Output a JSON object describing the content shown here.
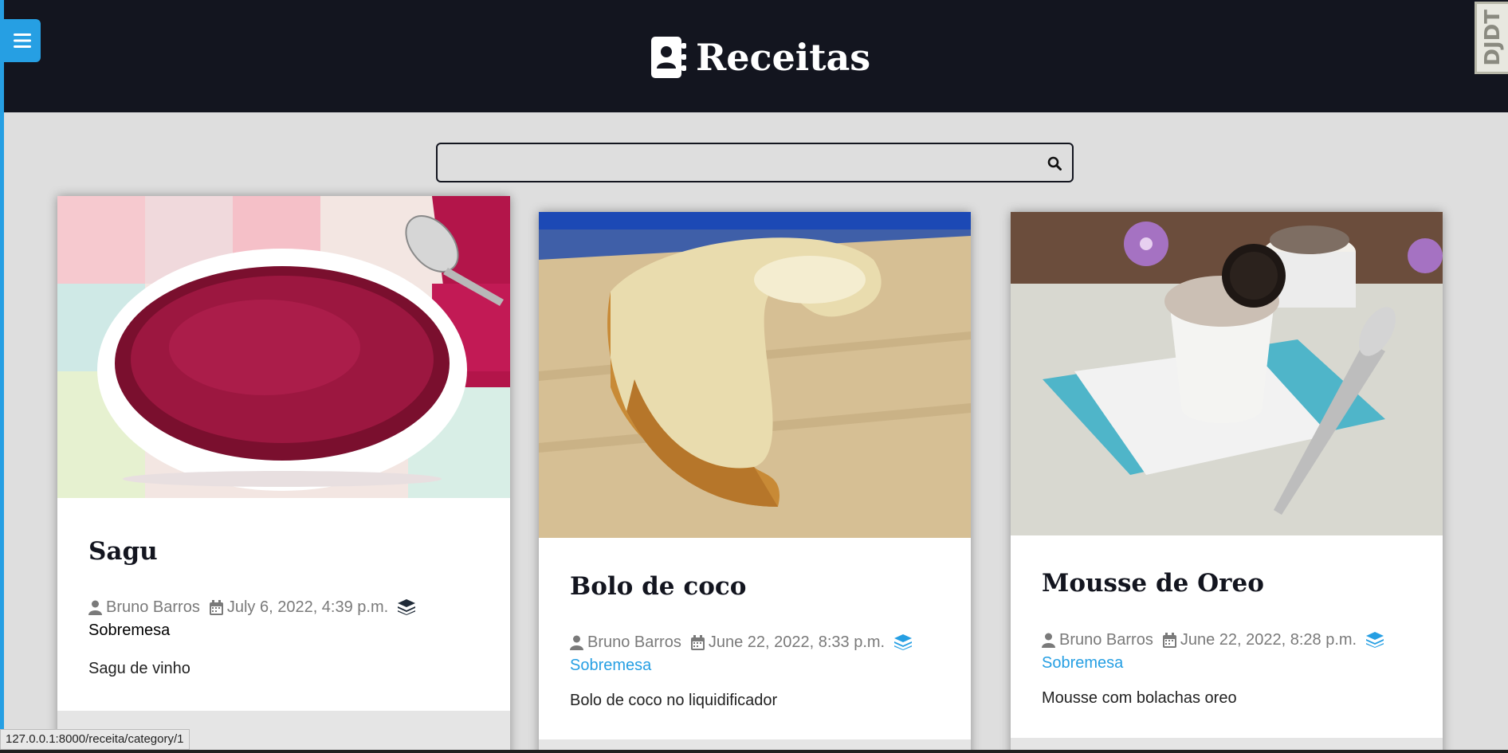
{
  "header": {
    "title": "Receitas",
    "menu_icon": "bars-icon",
    "brand_icon": "address-book-icon"
  },
  "debug_toolbar": {
    "label": "DJDT"
  },
  "search": {
    "placeholder": "",
    "value": "",
    "icon": "search-icon"
  },
  "recipes": [
    {
      "title": "Sagu",
      "author": "Bruno Barros",
      "date": "July 6, 2022, 4:39 p.m.",
      "category": "Sobremesa",
      "description": "Sagu de vinho",
      "image": "bowl of sagu with red wine tapioca pearls"
    },
    {
      "title": "Bolo de coco",
      "author": "Bruno Barros",
      "date": "June 22, 2022, 8:33 p.m.",
      "category": "Sobremesa",
      "description": "Bolo de coco no liquidificador",
      "image": "slice of coconut cake on wooden board"
    },
    {
      "title": "Mousse de Oreo",
      "author": "Bruno Barros",
      "date": "June 22, 2022, 8:28 p.m.",
      "category": "Sobremesa",
      "description": "Mousse com bolachas oreo",
      "image": "oreo mousse cups on blue plate"
    }
  ],
  "status_bar": {
    "url": "127.0.0.1:8000/receita/category/1"
  },
  "colors": {
    "header_bg": "#13151f",
    "accent": "#269fe3",
    "page_bg": "#dedede"
  }
}
